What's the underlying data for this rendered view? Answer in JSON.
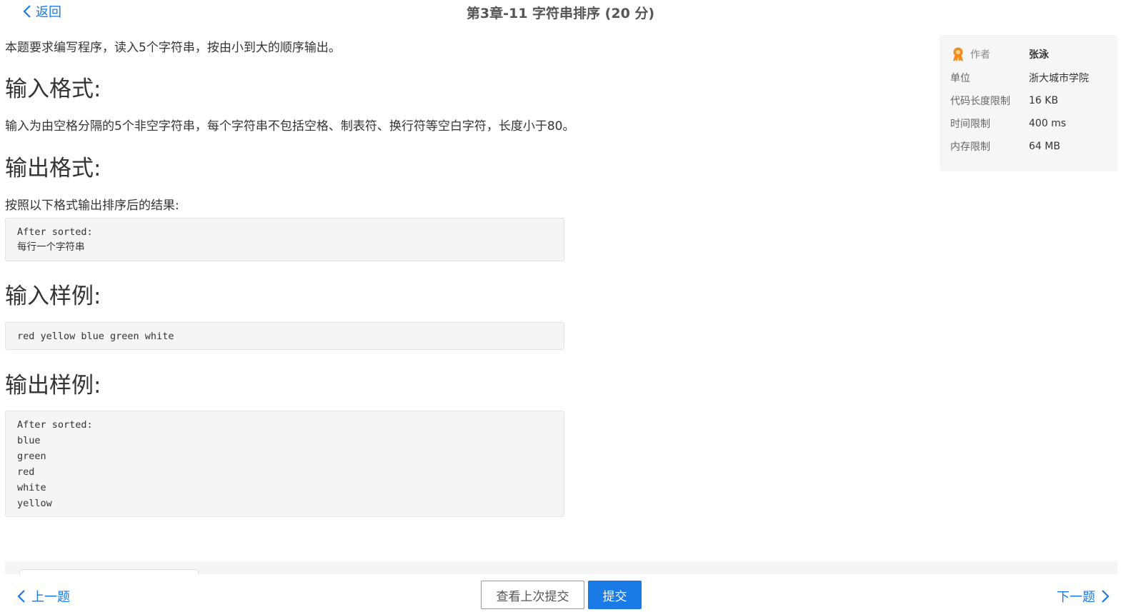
{
  "header": {
    "back_label": "返回",
    "title": "第3章-11 字符串排序 (20 分)"
  },
  "problem": {
    "intro": "本题要求编写程序，读入5个字符串，按由小到大的顺序输出。",
    "input_format_heading": "输入格式:",
    "input_format_text": "输入为由空格分隔的5个非空字符串，每个字符串不包括空格、制表符、换行符等空白字符，长度小于80。",
    "output_format_heading": "输出格式:",
    "output_format_text": "按照以下格式输出排序后的结果:",
    "output_format_code": [
      "After sorted:",
      "每行一个字符串"
    ],
    "sample_input_heading": "输入样例:",
    "sample_input_code": [
      "red yellow blue green white"
    ],
    "sample_output_heading": "输出样例:",
    "sample_output_code": [
      "After sorted:",
      "blue",
      "green",
      "red",
      "white",
      "yellow"
    ]
  },
  "info": {
    "author_label": "作者",
    "author_value": "张泳",
    "org_label": "单位",
    "org_value": "浙大城市学院",
    "code_limit_label": "代码长度限制",
    "code_limit_value": "16 KB",
    "time_limit_label": "时间限制",
    "time_limit_value": "400 ms",
    "memory_limit_label": "内存限制",
    "memory_limit_value": "64 MB"
  },
  "footer": {
    "prev_label": "上一题",
    "view_last_label": "查看上次提交",
    "submit_label": "提交",
    "next_label": "下一题"
  },
  "colors": {
    "accent": "#1a7ae6",
    "award_icon": "#f08c1e"
  }
}
